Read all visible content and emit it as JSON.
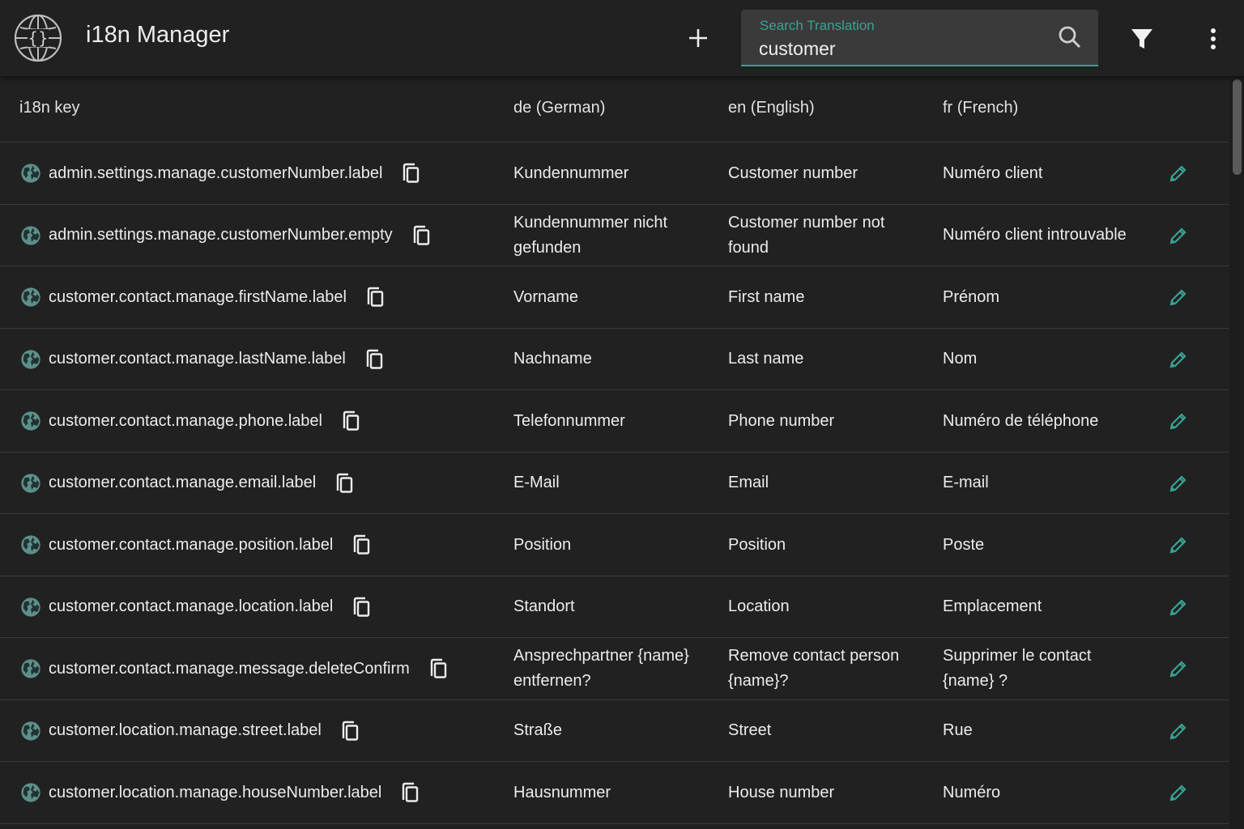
{
  "app": {
    "title": "i18n Manager",
    "logo_icon": "globe-braces-icon"
  },
  "toolbar": {
    "add_icon": "plus-icon",
    "filter_icon": "filter-icon",
    "more_icon": "more-vert-icon"
  },
  "search": {
    "label": "Search Translation",
    "value": "customer",
    "icon": "search-icon"
  },
  "colors": {
    "background": "#212121",
    "accent": "#37a393",
    "divider": "#3a3a3a",
    "search_field": "#3a3a3a"
  },
  "table": {
    "columns": [
      "i18n key",
      "de (German)",
      "en (English)",
      "fr (French)"
    ],
    "rows": [
      {
        "key": "admin.settings.manage.customerNumber.label",
        "de": "Kundennummer",
        "en": "Customer number",
        "fr": "Numéro client"
      },
      {
        "key": "admin.settings.manage.customerNumber.empty",
        "de": "Kundennummer nicht gefunden",
        "en": "Customer number not found",
        "fr": "Numéro client introuvable"
      },
      {
        "key": "customer.contact.manage.firstName.label",
        "de": "Vorname",
        "en": "First name",
        "fr": "Prénom"
      },
      {
        "key": "customer.contact.manage.lastName.label",
        "de": "Nachname",
        "en": "Last name",
        "fr": "Nom"
      },
      {
        "key": "customer.contact.manage.phone.label",
        "de": "Telefonnummer",
        "en": "Phone number",
        "fr": "Numéro de téléphone"
      },
      {
        "key": "customer.contact.manage.email.label",
        "de": "E-Mail",
        "en": "Email",
        "fr": "E-mail"
      },
      {
        "key": "customer.contact.manage.position.label",
        "de": "Position",
        "en": "Position",
        "fr": "Poste"
      },
      {
        "key": "customer.contact.manage.location.label",
        "de": "Standort",
        "en": "Location",
        "fr": "Emplacement"
      },
      {
        "key": "customer.contact.manage.message.deleteConfirm",
        "de": "Ansprechpartner {name} entfernen?",
        "en": "Remove contact person {name}?",
        "fr": "Supprimer le contact {name} ?"
      },
      {
        "key": "customer.location.manage.street.label",
        "de": "Straße",
        "en": "Street",
        "fr": "Rue"
      },
      {
        "key": "customer.location.manage.houseNumber.label",
        "de": "Hausnummer",
        "en": "House number",
        "fr": "Numéro"
      }
    ],
    "row_icons": {
      "scope": "globe-icon",
      "copy": "copy-icon",
      "edit": "edit-pencil-icon"
    }
  }
}
